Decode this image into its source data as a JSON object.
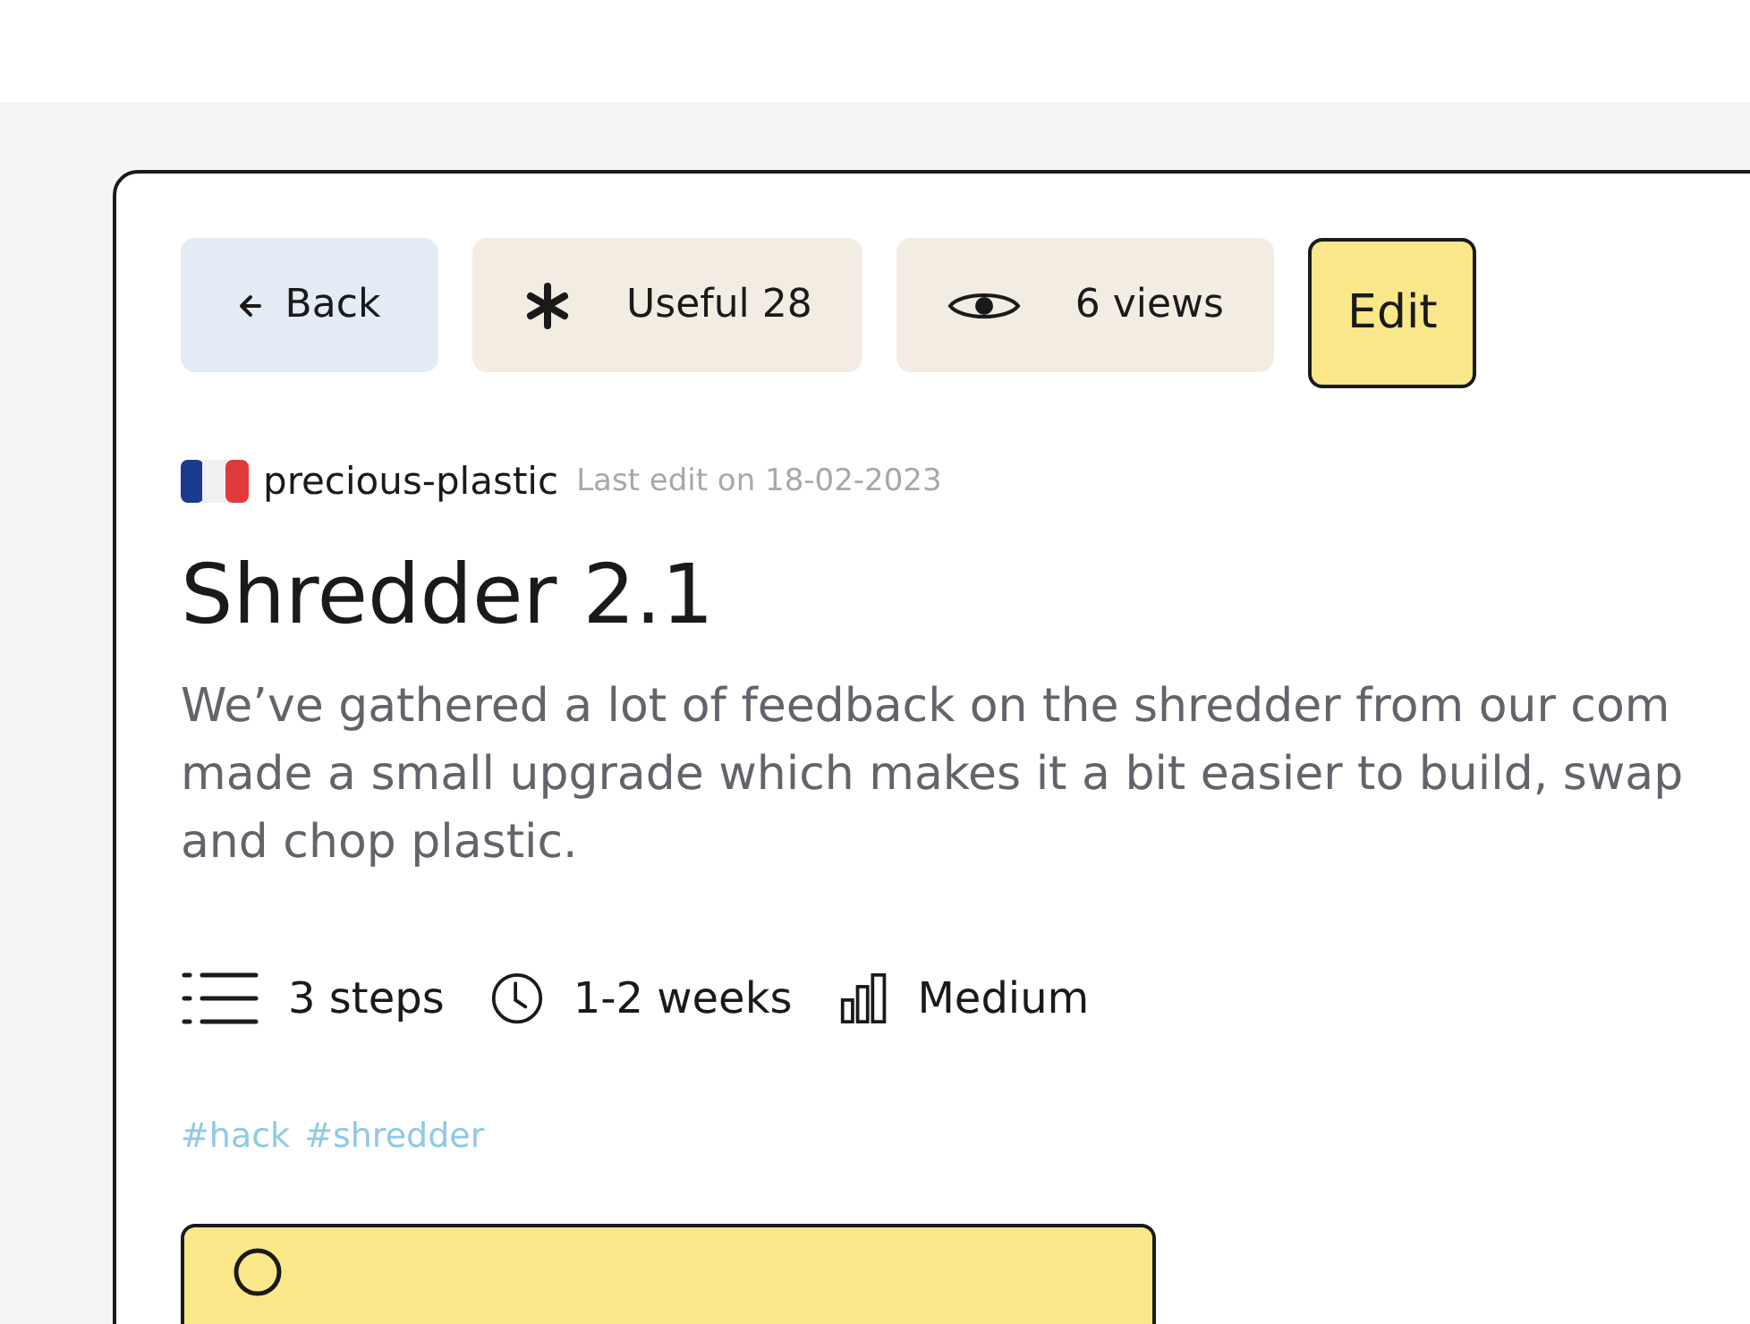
{
  "actions": [
    {
      "kind": "back",
      "label": "Back"
    },
    {
      "kind": "useful",
      "label": "Useful 28"
    },
    {
      "kind": "views",
      "label": "6 views"
    },
    {
      "kind": "edit",
      "label": "Edit"
    }
  ],
  "author": {
    "name": "precious-plastic",
    "last_edit": "Last edit on 18-02-2023"
  },
  "title": "Shredder 2.1",
  "description_lines": [
    "We’ve gathered a lot of feedback on the shredder from our com",
    "made a small upgrade which makes it a bit easier to build, swap",
    "and chop plastic."
  ],
  "stats": [
    {
      "kind": "steps",
      "label": "3 steps"
    },
    {
      "kind": "time",
      "label": "1-2 weeks"
    },
    {
      "kind": "difficulty",
      "label": "Medium"
    }
  ],
  "tags": [
    "#hack",
    "#shredder"
  ]
}
